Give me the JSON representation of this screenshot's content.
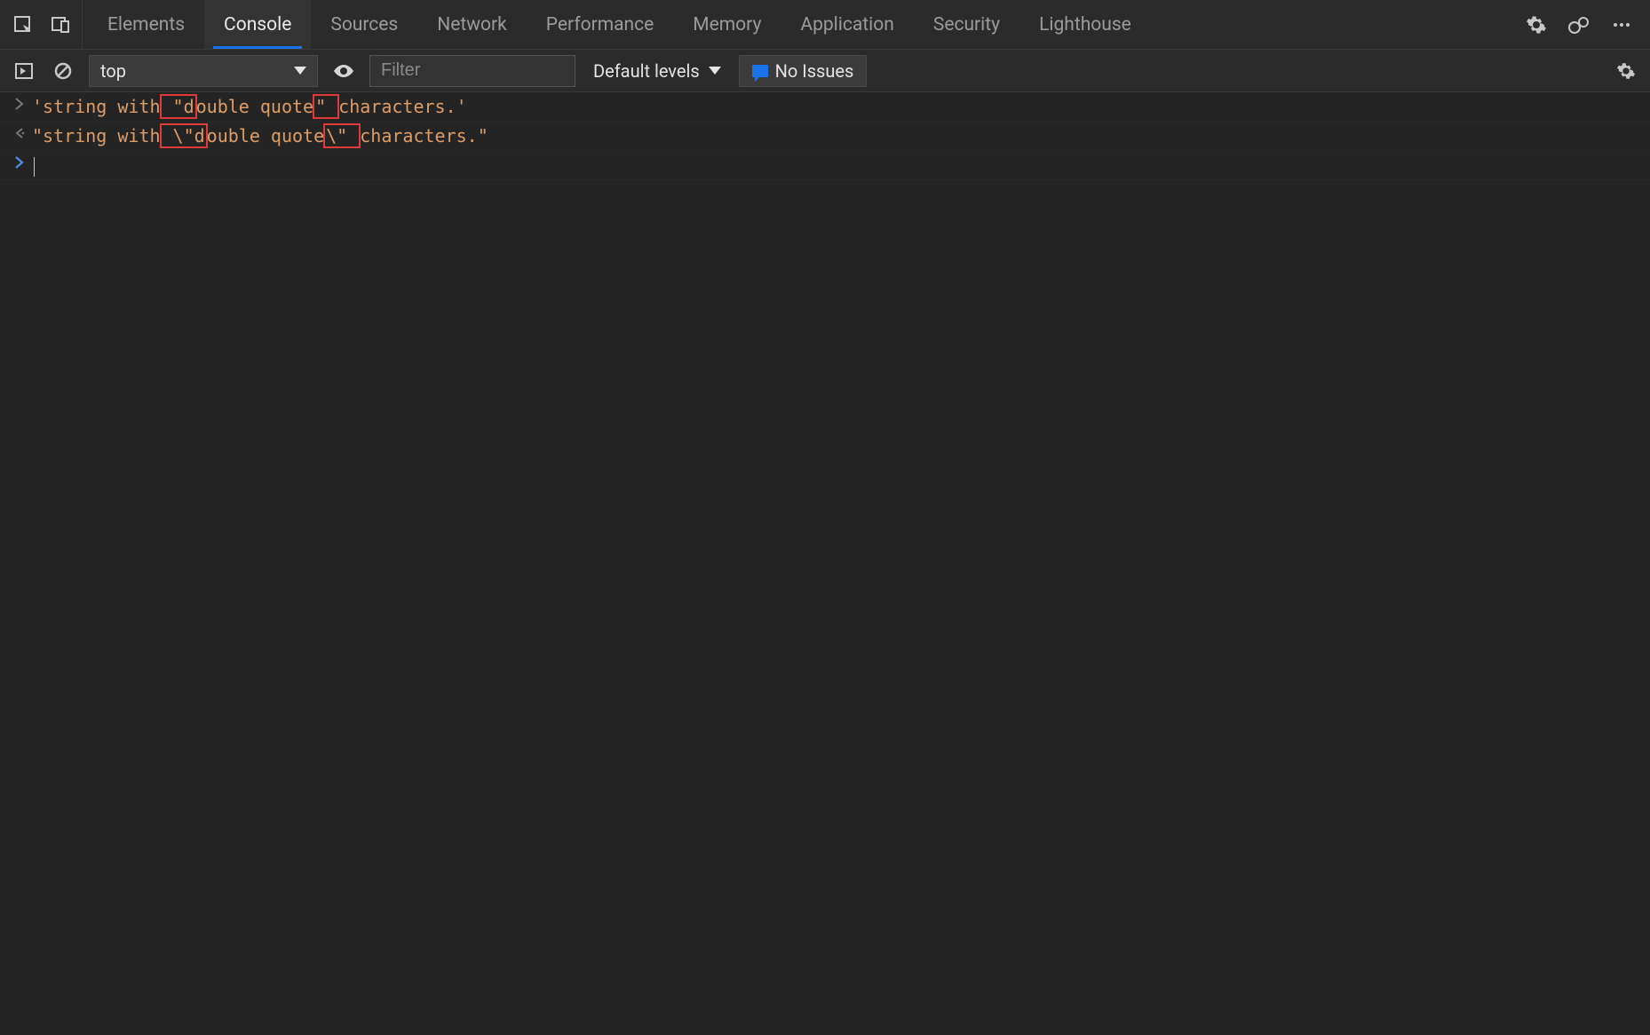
{
  "tabs": {
    "items": [
      {
        "label": "Elements"
      },
      {
        "label": "Console"
      },
      {
        "label": "Sources"
      },
      {
        "label": "Network"
      },
      {
        "label": "Performance"
      },
      {
        "label": "Memory"
      },
      {
        "label": "Application"
      },
      {
        "label": "Security"
      },
      {
        "label": "Lighthouse"
      }
    ],
    "active_index": 1
  },
  "toolbar": {
    "context_label": "top",
    "filter_placeholder": "Filter",
    "levels_label": "Default levels",
    "issues_label": "No Issues"
  },
  "console": {
    "input_line": {
      "pre": "'string with",
      "hl1": " \"d",
      "mid": "ouble quote",
      "hl2": "\" ",
      "post": "characters.'"
    },
    "output_line": {
      "pre": "\"string with",
      "hl1": " \\\"d",
      "mid": "ouble quote",
      "hl2": "\\\" ",
      "post": "characters.\""
    }
  }
}
